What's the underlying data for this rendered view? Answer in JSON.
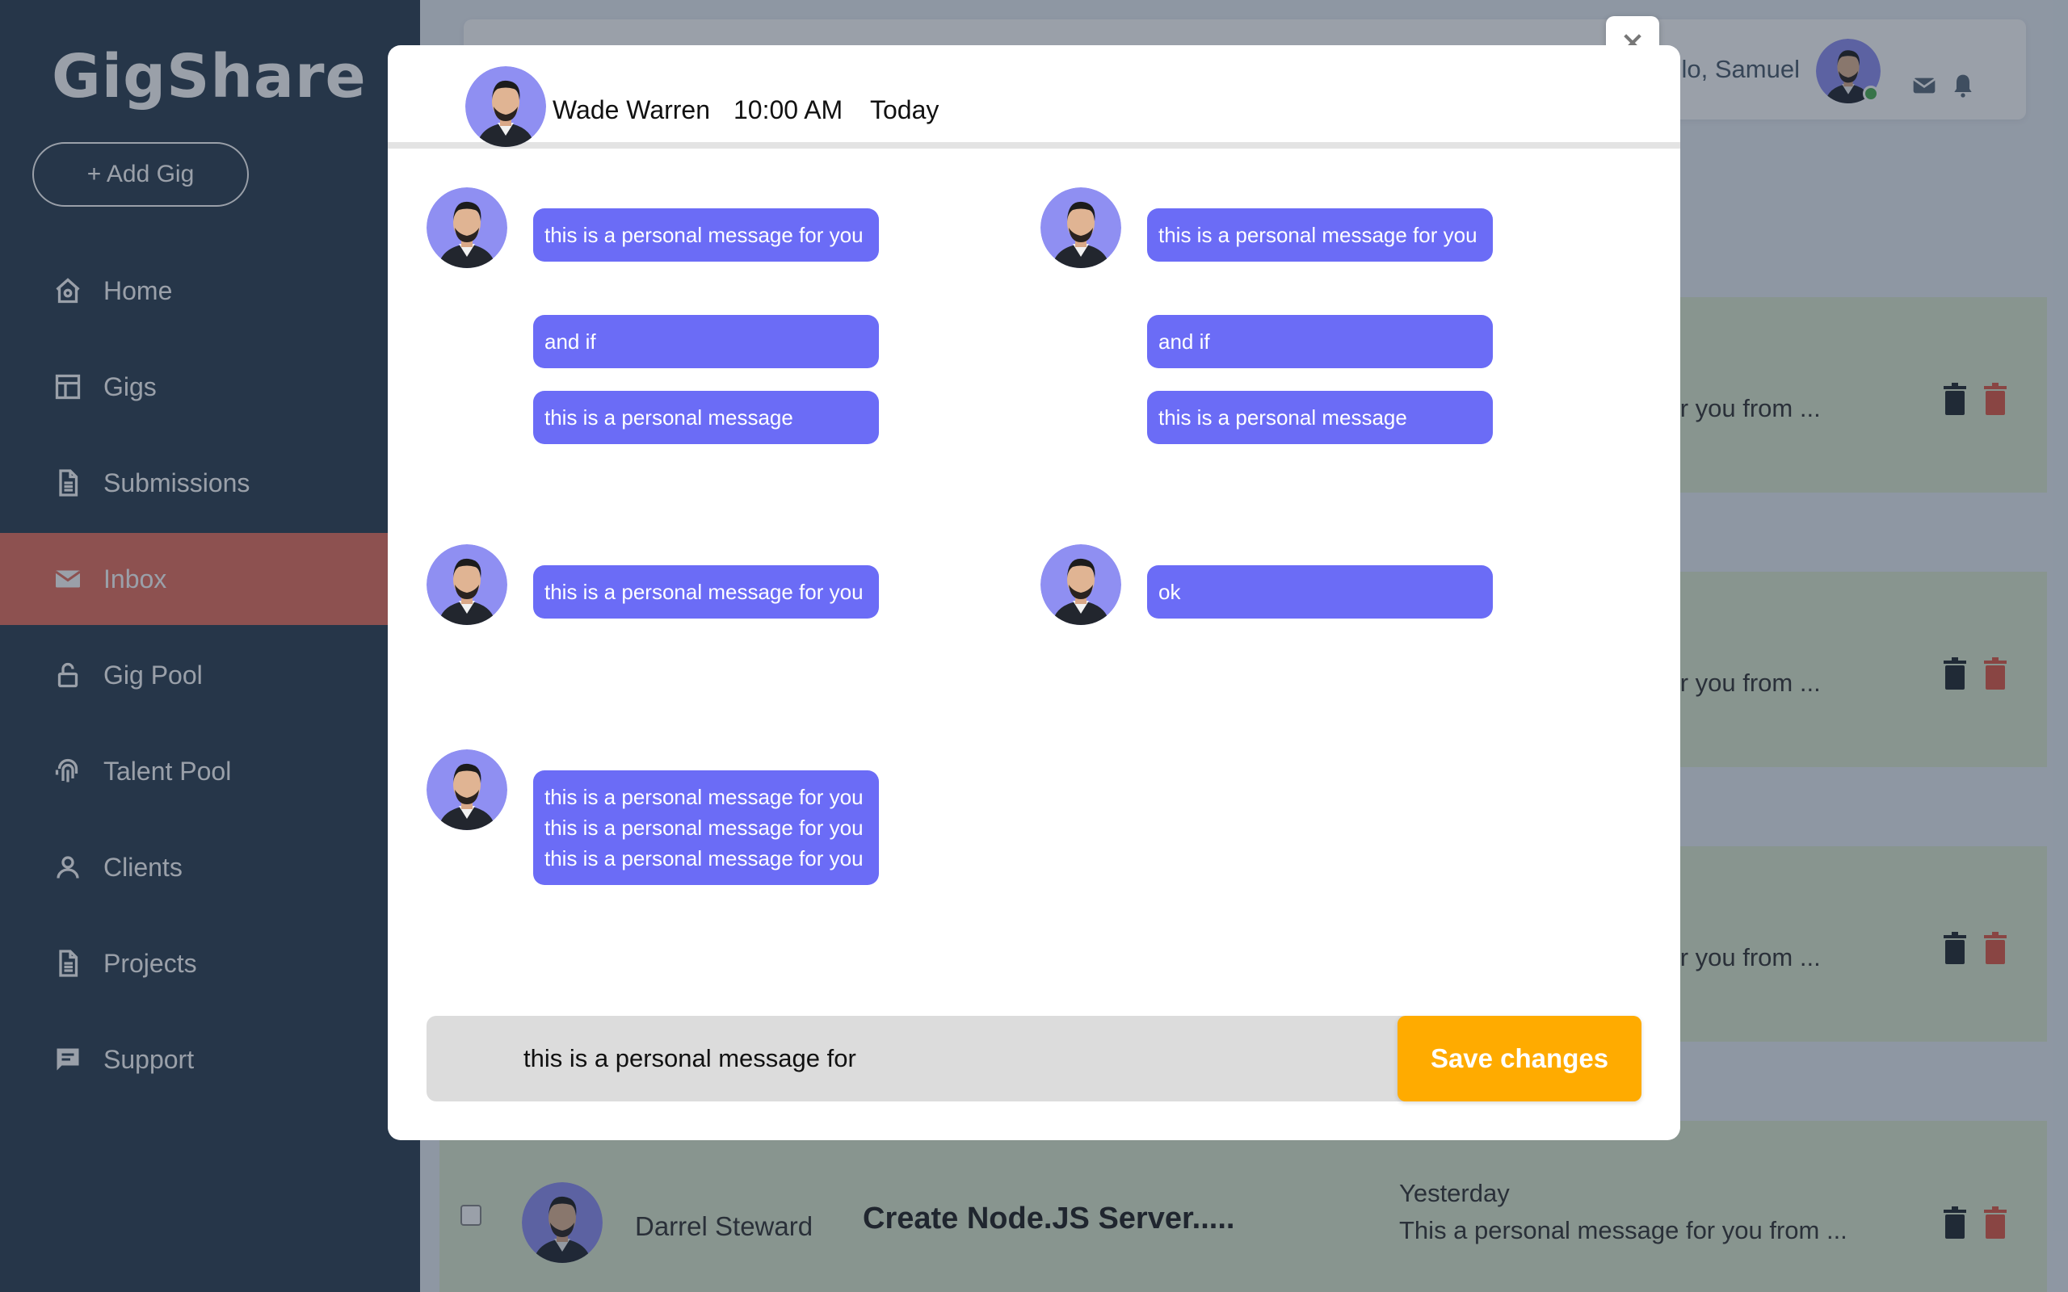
{
  "app": {
    "logo": "GigShare",
    "add_gig_label": "+ Add Gig"
  },
  "sidebar": {
    "items": [
      {
        "label": "Home",
        "icon": "home-icon",
        "active": false
      },
      {
        "label": "Gigs",
        "icon": "gigs-icon",
        "active": false
      },
      {
        "label": "Submissions",
        "icon": "document-icon",
        "active": false
      },
      {
        "label": "Inbox",
        "icon": "mail-icon",
        "active": true
      },
      {
        "label": "Gig Pool",
        "icon": "lock-icon",
        "active": false
      },
      {
        "label": "Talent Pool",
        "icon": "fingerprint-icon",
        "active": false
      },
      {
        "label": "Clients",
        "icon": "user-icon",
        "active": false
      },
      {
        "label": "Projects",
        "icon": "document-icon",
        "active": false
      },
      {
        "label": "Support",
        "icon": "chat-icon",
        "active": false
      }
    ]
  },
  "header": {
    "greeting": "lo, Samuel"
  },
  "inbox": {
    "rows": [
      {
        "preview_partial": "e for you from ..."
      },
      {
        "preview_partial": "e for you from ..."
      },
      {
        "preview_partial": "e for you from ..."
      },
      {
        "name": "Darrel Steward",
        "title": "Create Node.JS Server.....",
        "day": "Yesterday",
        "preview": "This a personal message for you from ..."
      }
    ]
  },
  "modal": {
    "contact_name": "Wade Warren",
    "time": "10:00 AM",
    "day": "Today",
    "left_messages": [
      "this is a personal message for you",
      "and if",
      "this is a personal message",
      "this is a personal message for you",
      "this is a personal message for you this is a personal message for you this is a personal message for you"
    ],
    "right_messages": [
      "this is a personal message for you",
      "and if",
      "this is a personal message",
      "ok"
    ],
    "composer_value": "this is a personal message for",
    "save_label": "Save changes"
  },
  "colors": {
    "sidebar_bg": "#2c3e50",
    "active_item": "#e8705e",
    "bubble": "#6b6cf6",
    "save_button": "#ffab00",
    "row_bg": "#dfeccf",
    "avatar_bg": "#8f8ff2"
  }
}
